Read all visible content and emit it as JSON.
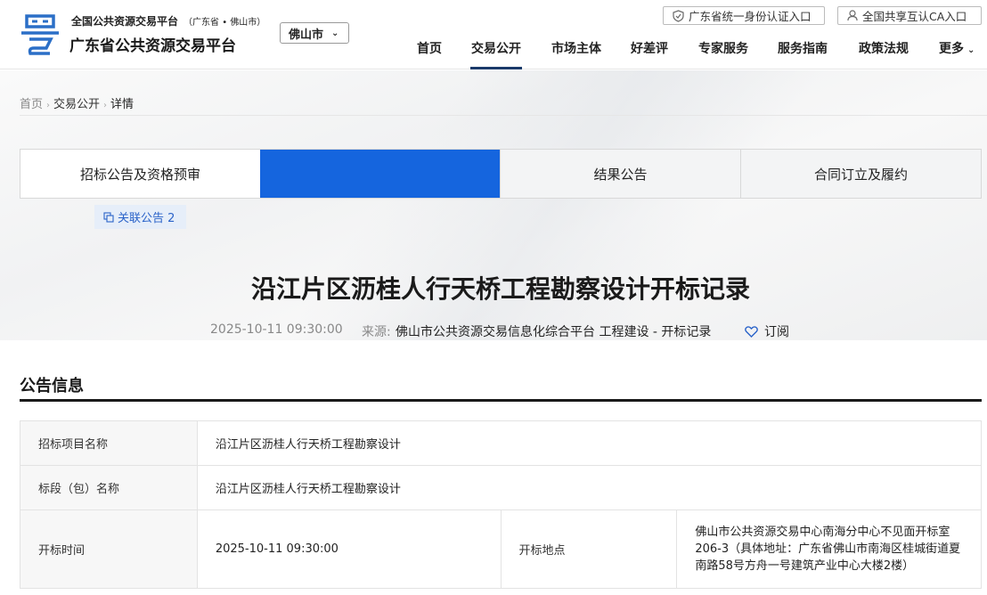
{
  "header": {
    "brand_sub": "全国公共资源交易平台",
    "brand_sub_region": "（广东省 • 佛山市）",
    "brand_main": "广东省公共资源交易平台",
    "city": "佛山市",
    "top_buttons": [
      "广东省统一身份认证入口",
      "全国共享互认CA入口"
    ],
    "nav": [
      "首页",
      "交易公开",
      "市场主体",
      "好差评",
      "专家服务",
      "服务指南",
      "政策法规",
      "更多"
    ]
  },
  "breadcrumb": [
    "首页",
    "交易公开",
    "详情"
  ],
  "tabs": [
    "招标公告及资格预审",
    "",
    "结果公告",
    "合同订立及履约"
  ],
  "related_label": "关联公告 2",
  "title": "沿江片区沥桂人行天桥工程勘察设计开标记录",
  "meta": {
    "date": "2025-10-11 09:30:00",
    "source_label": "来源:",
    "source": "佛山市公共资源交易信息化综合平台 工程建设 - 开标记录",
    "subscribe": "订阅"
  },
  "section_title": "公告信息",
  "info": {
    "project_name_label": "招标项目名称",
    "project_name": "沿江片区沥桂人行天桥工程勘察设计",
    "section_name_label": "标段（包）名称",
    "section_name": "沿江片区沥桂人行天桥工程勘察设计",
    "open_time_label": "开标时间",
    "open_time": "2025-10-11 09:30:00",
    "open_place_label": "开标地点",
    "open_place": "佛山市公共资源交易中心南海分中心不见面开标室206-3（具体地址：广东省佛山市南海区桂城街道夏南路58号方舟一号建筑产业中心大楼2楼）"
  },
  "colors": {
    "accent": "#1565de",
    "nav_active": "#1a3a6a",
    "logo": "#2b6fc7"
  }
}
